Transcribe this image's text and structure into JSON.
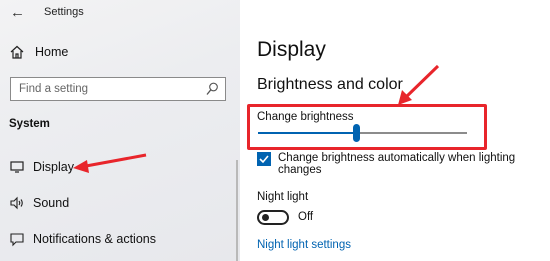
{
  "window": {
    "title": "Settings"
  },
  "sidebar": {
    "home_label": "Home",
    "search_placeholder": "Find a setting",
    "section_label": "System",
    "items": [
      {
        "label": "Display",
        "icon": "monitor-icon"
      },
      {
        "label": "Sound",
        "icon": "speaker-icon"
      },
      {
        "label": "Notifications & actions",
        "icon": "notification-icon"
      }
    ]
  },
  "main": {
    "page_title": "Display",
    "section_title": "Brightness and color",
    "brightness": {
      "label": "Change brightness",
      "value_percent": 47
    },
    "auto_brightness": {
      "label": "Change brightness automatically when lighting changes",
      "checked": true
    },
    "night_light": {
      "title": "Night light",
      "toggle_state": "Off",
      "settings_link": "Night light settings"
    }
  },
  "colors": {
    "accent": "#0063b1",
    "annotation": "#e8252b"
  }
}
